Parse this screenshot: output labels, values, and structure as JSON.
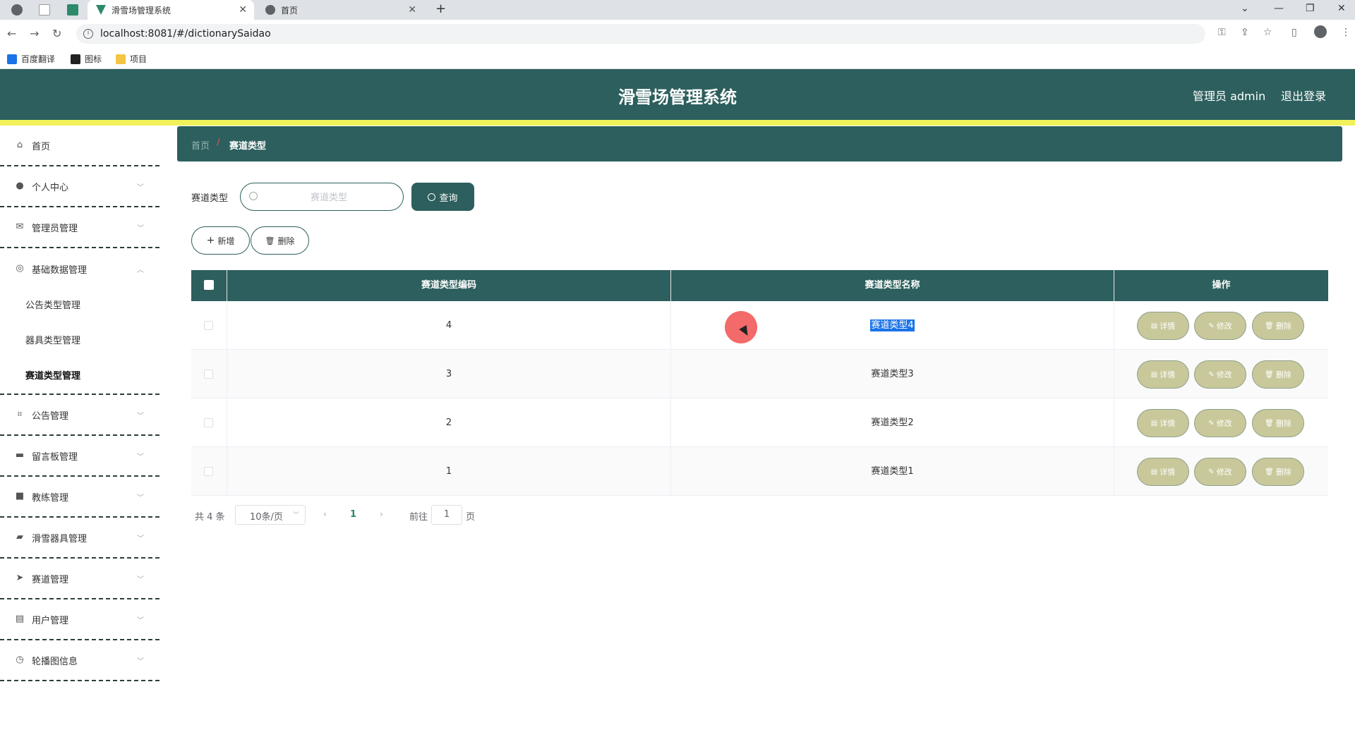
{
  "browser": {
    "tabs": [
      {
        "title": "滑雪场管理系统",
        "active": true
      },
      {
        "title": "首页",
        "active": false
      }
    ],
    "new_tab": "+",
    "close_glyph": "✕",
    "url": "localhost:8081/#/dictionarySaidao",
    "bookmarks": [
      {
        "label": "百度翻译",
        "icon": "translate-icon",
        "color": "#1a73e8"
      },
      {
        "label": "图标",
        "icon": "image-icon",
        "color": "#222222"
      },
      {
        "label": "项目",
        "icon": "folder-icon",
        "color": "#f4c542"
      }
    ]
  },
  "header": {
    "title": "滑雪场管理系统",
    "user": "管理员 admin",
    "logout": "退出登录"
  },
  "colors": {
    "primary": "#2c5f5d",
    "accent_bar": "#f1f15a",
    "action_button": "#c8c89a",
    "page_active": "#2c8a6a"
  },
  "sidebar": {
    "items": [
      {
        "label": "首页",
        "icon": "home-icon"
      },
      {
        "label": "个人中心",
        "icon": "user-icon"
      },
      {
        "label": "管理员管理",
        "icon": "mail-icon"
      },
      {
        "label": "基础数据管理",
        "icon": "compass-icon",
        "expanded": true,
        "children": [
          "公告类型管理",
          "器具类型管理",
          "赛道类型管理"
        ]
      },
      {
        "label": "公告管理",
        "icon": "crop-icon"
      },
      {
        "label": "留言板管理",
        "icon": "briefcase-icon"
      },
      {
        "label": "教练管理",
        "icon": "camera-icon"
      },
      {
        "label": "滑雪器具管理",
        "icon": "drive-icon"
      },
      {
        "label": "赛道管理",
        "icon": "send-icon"
      },
      {
        "label": "用户管理",
        "icon": "clipboard-icon"
      },
      {
        "label": "轮播图信息",
        "icon": "clock-icon"
      }
    ],
    "active_child": "赛道类型管理"
  },
  "breadcrumb": {
    "home": "首页",
    "separator": "/",
    "current": "赛道类型"
  },
  "search": {
    "label": "赛道类型",
    "placeholder": "赛道类型",
    "value": "",
    "button": "查询"
  },
  "actions": {
    "add": "新增",
    "delete": "删除"
  },
  "table": {
    "columns": [
      "赛道类型编码",
      "赛道类型名称",
      "操作"
    ],
    "rows": [
      {
        "code": "4",
        "name": "赛道类型4"
      },
      {
        "code": "3",
        "name": "赛道类型3"
      },
      {
        "code": "2",
        "name": "赛道类型2"
      },
      {
        "code": "1",
        "name": "赛道类型1"
      }
    ],
    "row_actions": {
      "detail": "详情",
      "edit": "修改",
      "delete": "删除"
    }
  },
  "pagination": {
    "total": "共 4 条",
    "page_size": "10条/页",
    "current": "1",
    "goto_label": "前往",
    "goto_value": "1",
    "page_suffix": "页"
  }
}
